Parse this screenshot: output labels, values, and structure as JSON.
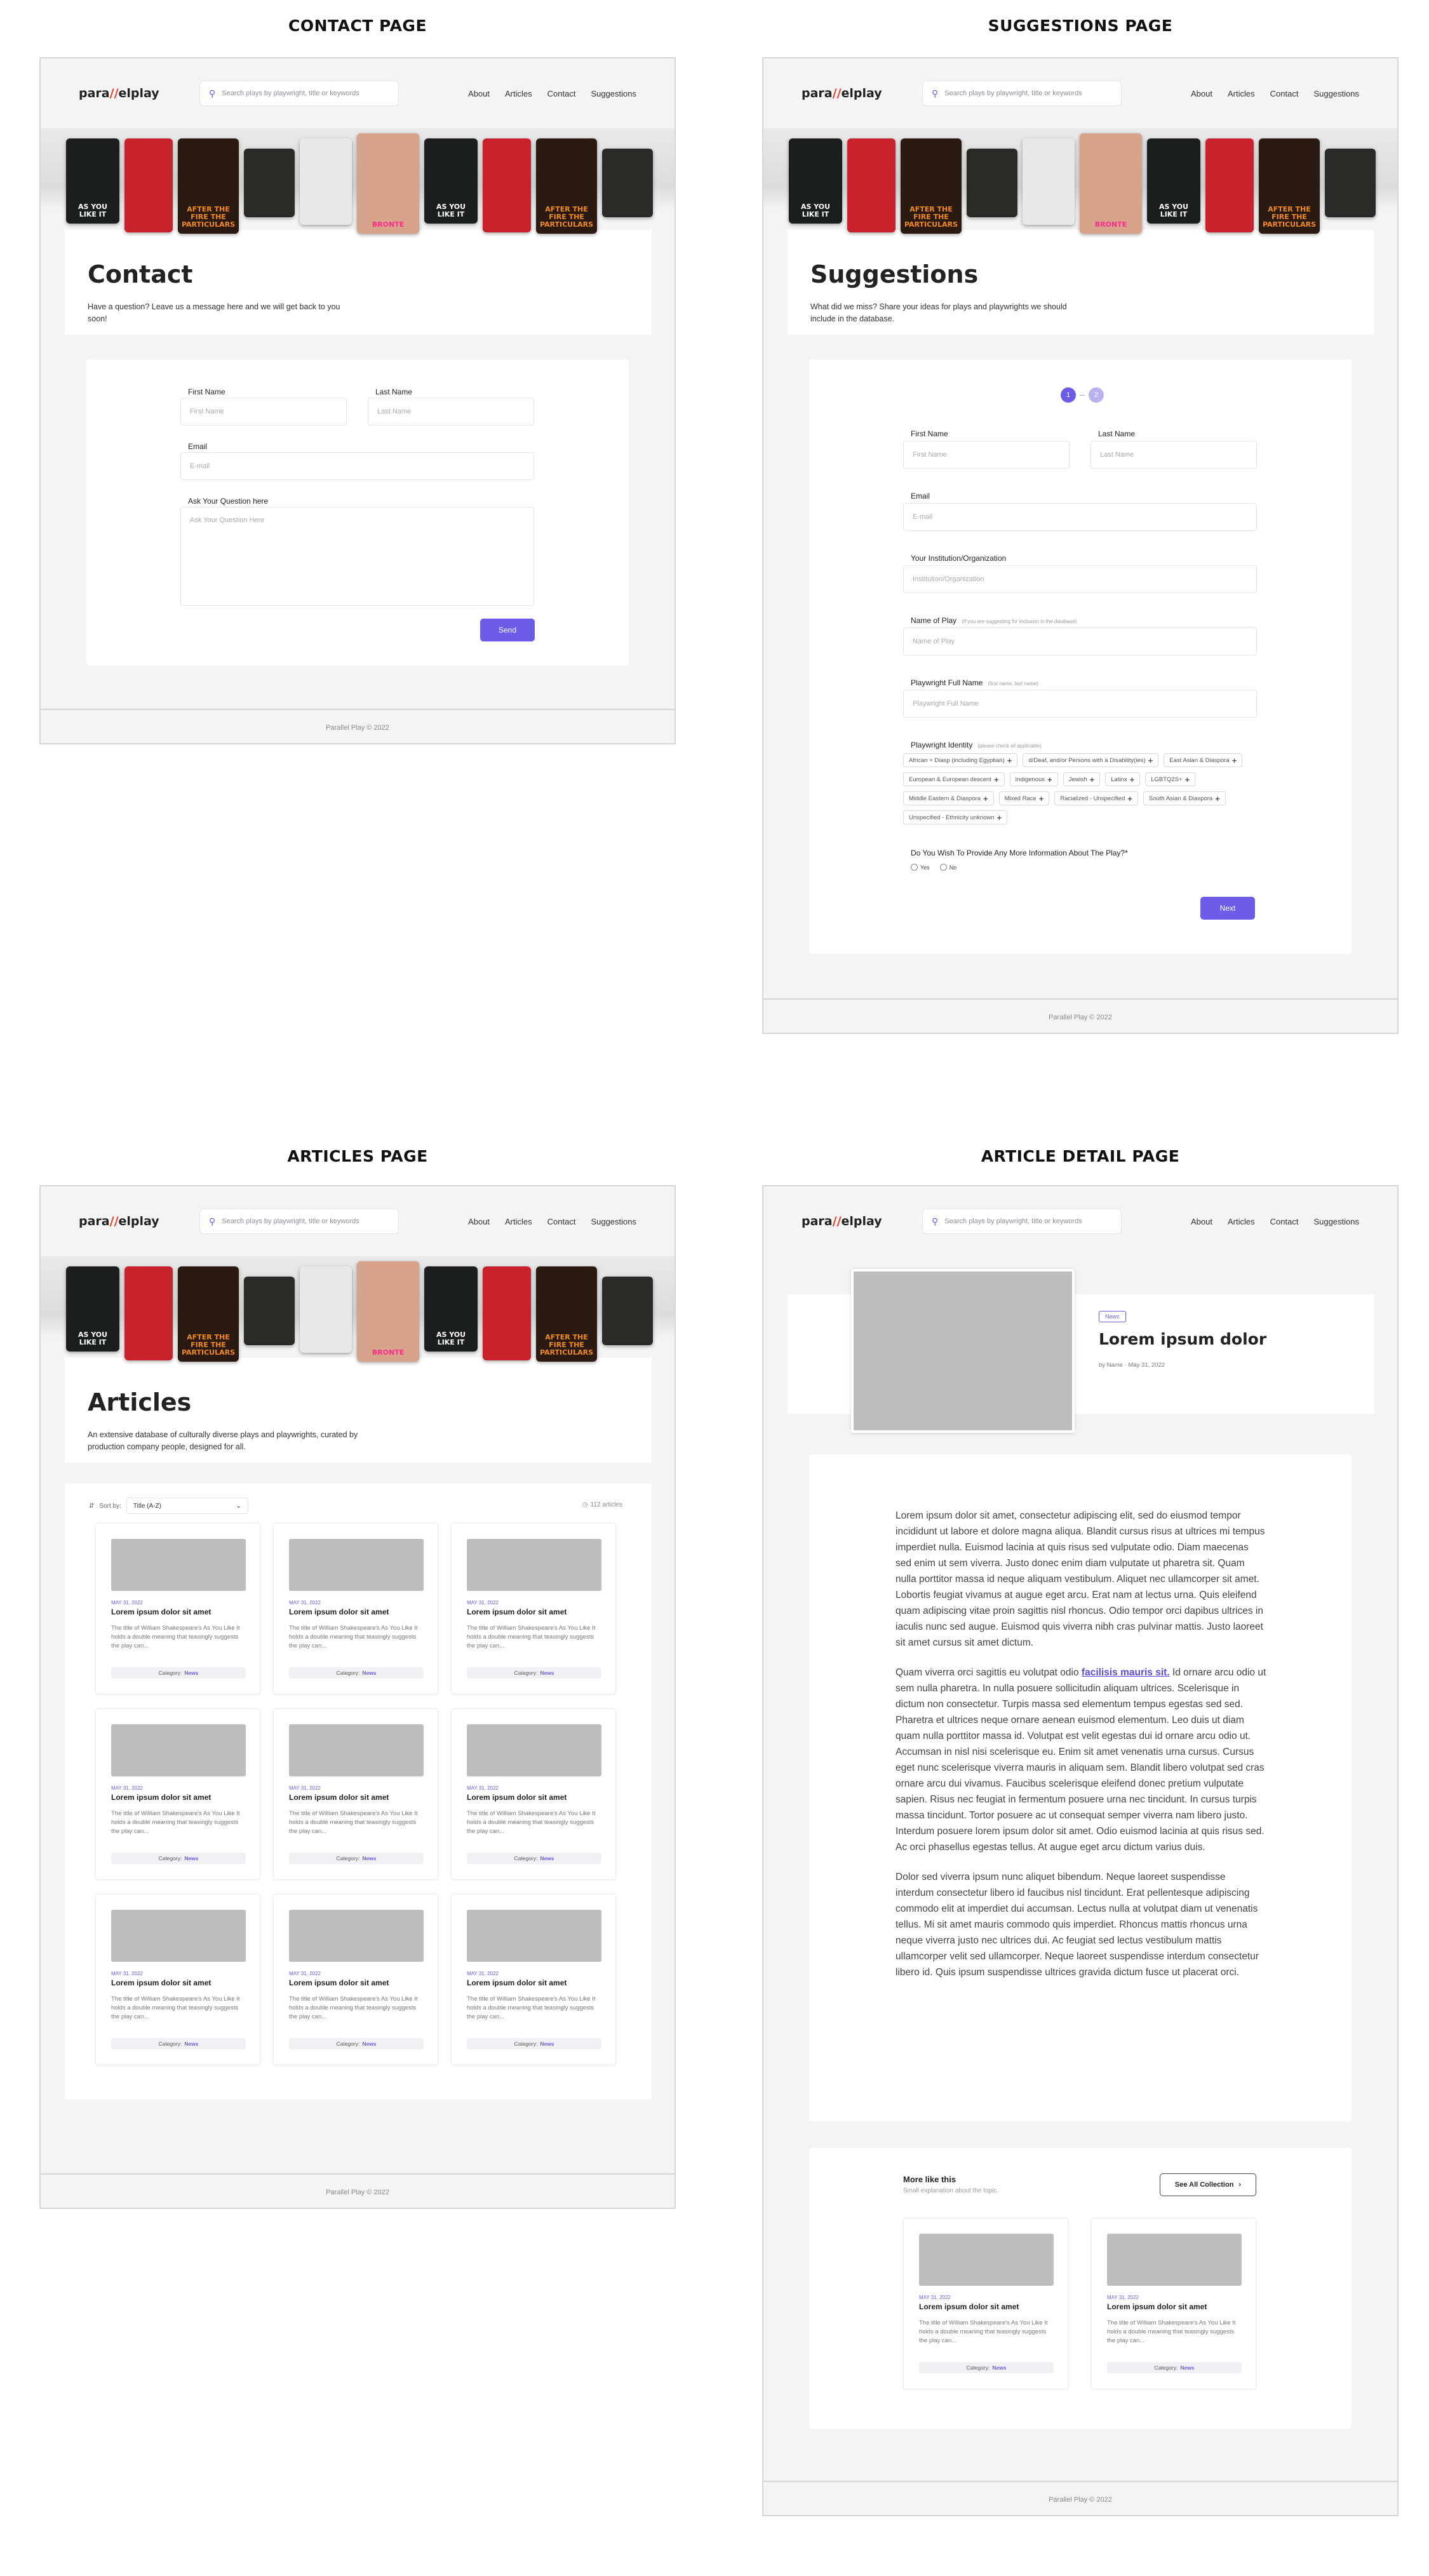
{
  "sections": {
    "contact": "CONTACT PAGE",
    "suggestions": "SUGGESTIONS PAGE",
    "articles": "ARTICLES PAGE",
    "article_detail": "ARTICLE DETAIL PAGE"
  },
  "nav": {
    "logo_a": "para",
    "logo_slash": "//",
    "logo_b": "elplay",
    "search_placeholder": "Search plays by playwright, title or keywords",
    "links": [
      "About",
      "Articles",
      "Contact",
      "Suggestions"
    ]
  },
  "covers": [
    {
      "text": "AS YOU LIKE IT",
      "color": "#1a1f1c",
      "accent": "#ffffff"
    },
    {
      "text": "",
      "color": "#c8232c",
      "accent": "#f7d26b"
    },
    {
      "text": "AFTER THE FIRE THE PARTICULARS",
      "color": "#2a1a12",
      "accent": "#f08a1e"
    },
    {
      "text": "",
      "color": "#2b2a26",
      "accent": "#6a6a5a"
    },
    {
      "text": "",
      "color": "#e8e8e6",
      "accent": "#333333"
    },
    {
      "text": "BRONTE",
      "color": "#d7a38b",
      "accent": "#ff2c8a"
    },
    {
      "text": "AS YOU LIKE IT",
      "color": "#1a1f1c",
      "accent": "#ffffff"
    },
    {
      "text": "",
      "color": "#c8232c",
      "accent": "#f7d26b"
    },
    {
      "text": "AFTER THE FIRE THE PARTICULARS",
      "color": "#2a1a12",
      "accent": "#f08a1e"
    },
    {
      "text": "",
      "color": "#2b2a26",
      "accent": "#6a6a5a"
    }
  ],
  "contact": {
    "title": "Contact",
    "intro": "Have a question? Leave us a message here and we will get back to you soon!",
    "first_name_label": "First Name",
    "first_name_ph": "First Name",
    "last_name_label": "Last Name",
    "last_name_ph": "Last Name",
    "email_label": "Email",
    "email_ph": "E-mail",
    "question_label": "Ask Your Question here",
    "question_ph": "Ask Your Question Here",
    "send": "Send",
    "footer": "Parallel Play © 2022"
  },
  "suggestions": {
    "title": "Suggestions",
    "intro": "What did we miss? Share your ideas for plays and playwrights we should include in the database.",
    "step1": "1",
    "step2": "2",
    "first_name_label": "First Name",
    "first_name_ph": "First Name",
    "last_name_label": "Last Name",
    "last_name_ph": "Last Name",
    "email_label": "Email",
    "email_ph": "E-mail",
    "inst_label": "Your Institution/Organization",
    "inst_ph": "Institution/Organization",
    "play_label": "Name of Play",
    "play_hint": "(If you are suggesting for inclusion in the database)",
    "play_ph": "Name of Play",
    "pw_label": "Playwright Full Name",
    "pw_hint": "(first name, last name)",
    "pw_ph": "Playwright Full Name",
    "identity_label": "Playwright Identity",
    "identity_hint": "(please check all applicable)",
    "identities": [
      "African + Diasp (including Egyptian)",
      "d/Deaf, and/or Persons with a Disability(ies)",
      "East Asian & Diaspora",
      "European & European descent",
      "Indigenous",
      "Jewish",
      "Latinx",
      "LGBTQ2S+",
      "Middle Eastern & Diaspora",
      "Mixed Race",
      "Racialized - Unspecified",
      "South Asian & Diaspora",
      "Unspecified - Ethnicity unknown"
    ],
    "more_info_label": "Do You Wish To Provide Any More Information About The Play?*",
    "yes": "Yes",
    "no": "No",
    "next": "Next",
    "footer": "Parallel Play © 2022"
  },
  "articles": {
    "title": "Articles",
    "intro": "An extensive database of culturally diverse plays and playwrights, curated by production company people, designed for all.",
    "sort_label": "Sort by:",
    "sort_value": "Title (A-Z)",
    "count": "112 articles",
    "card": {
      "date": "MAY 31, 2022",
      "title": "Lorem ipsum dolor sit amet",
      "desc": "The title of William Shakespeare's As You Like It holds a double meaning that teasingly suggests the play can...",
      "cat_label": "Category:",
      "cat_value": "News"
    },
    "footer": "Parallel Play © 2022"
  },
  "detail": {
    "tag": "News",
    "title": "Lorem ipsum dolor",
    "byline": "by Name · May 31, 2022",
    "p1": "Lorem ipsum dolor sit amet, consectetur adipiscing elit, sed do eiusmod tempor incididunt ut labore et dolore magna aliqua. Blandit cursus risus at ultrices mi tempus imperdiet nulla. Euismod lacinia at quis risus sed vulputate odio. Diam maecenas sed enim ut sem viverra. Justo donec enim diam vulputate ut pharetra sit. Quam nulla porttitor massa id neque aliquam vestibulum. Aliquet nec ullamcorper sit amet. Lobortis feugiat vivamus at augue eget arcu. Erat nam at lectus urna. Quis eleifend quam adipiscing vitae proin sagittis nisl rhoncus. Odio tempor orci dapibus ultrices in iaculis nunc sed augue. Euismod quis viverra nibh cras pulvinar mattis. Justo laoreet sit amet cursus sit amet dictum.",
    "p2_a": "Quam viverra orci sagittis eu volutpat odio ",
    "p2_link": "facilisis mauris sit.",
    "p2_b": " Id ornare arcu odio ut sem nulla pharetra. In nulla posuere sollicitudin aliquam ultrices. Scelerisque in dictum non consectetur. Turpis massa sed elementum tempus egestas sed sed. Pharetra et ultrices neque ornare aenean euismod elementum. Leo duis ut diam quam nulla porttitor massa id. Volutpat est velit egestas dui id ornare arcu odio ut. Accumsan in nisl nisi scelerisque eu. Enim sit amet venenatis urna cursus. Cursus eget nunc scelerisque viverra mauris in aliquam sem. Blandit libero volutpat sed cras ornare arcu dui vivamus. Faucibus scelerisque eleifend donec pretium vulputate sapien. Risus nec feugiat in fermentum posuere urna nec tincidunt. In cursus turpis massa tincidunt. Tortor posuere ac ut consequat semper viverra nam libero justo. Interdum posuere lorem ipsum dolor sit amet. Odio euismod lacinia at quis risus sed. Ac orci phasellus egestas tellus. At augue eget arcu dictum varius duis.",
    "p3": "Dolor sed viverra ipsum nunc aliquet bibendum. Neque laoreet suspendisse interdum consectetur libero id faucibus nisl tincidunt. Erat pellentesque adipiscing commodo elit at imperdiet dui accumsan. Lectus nulla at volutpat diam ut venenatis tellus. Mi sit amet mauris commodo quis imperdiet. Rhoncus mattis rhoncus urna neque viverra justo nec ultrices dui. Ac feugiat sed lectus vestibulum mattis ullamcorper velit sed ullamcorper. Neque laoreet suspendisse interdum consectetur libero id. Quis ipsum suspendisse ultrices gravida dictum fusce ut placerat orci.",
    "more_title": "More like this",
    "more_sub": "Small explanation about the topic.",
    "see_all": "See All Collection",
    "footer": "Parallel Play © 2022"
  },
  "colors": {
    "accent": "#6c5ce7",
    "logo_slash": "#e6402b"
  }
}
